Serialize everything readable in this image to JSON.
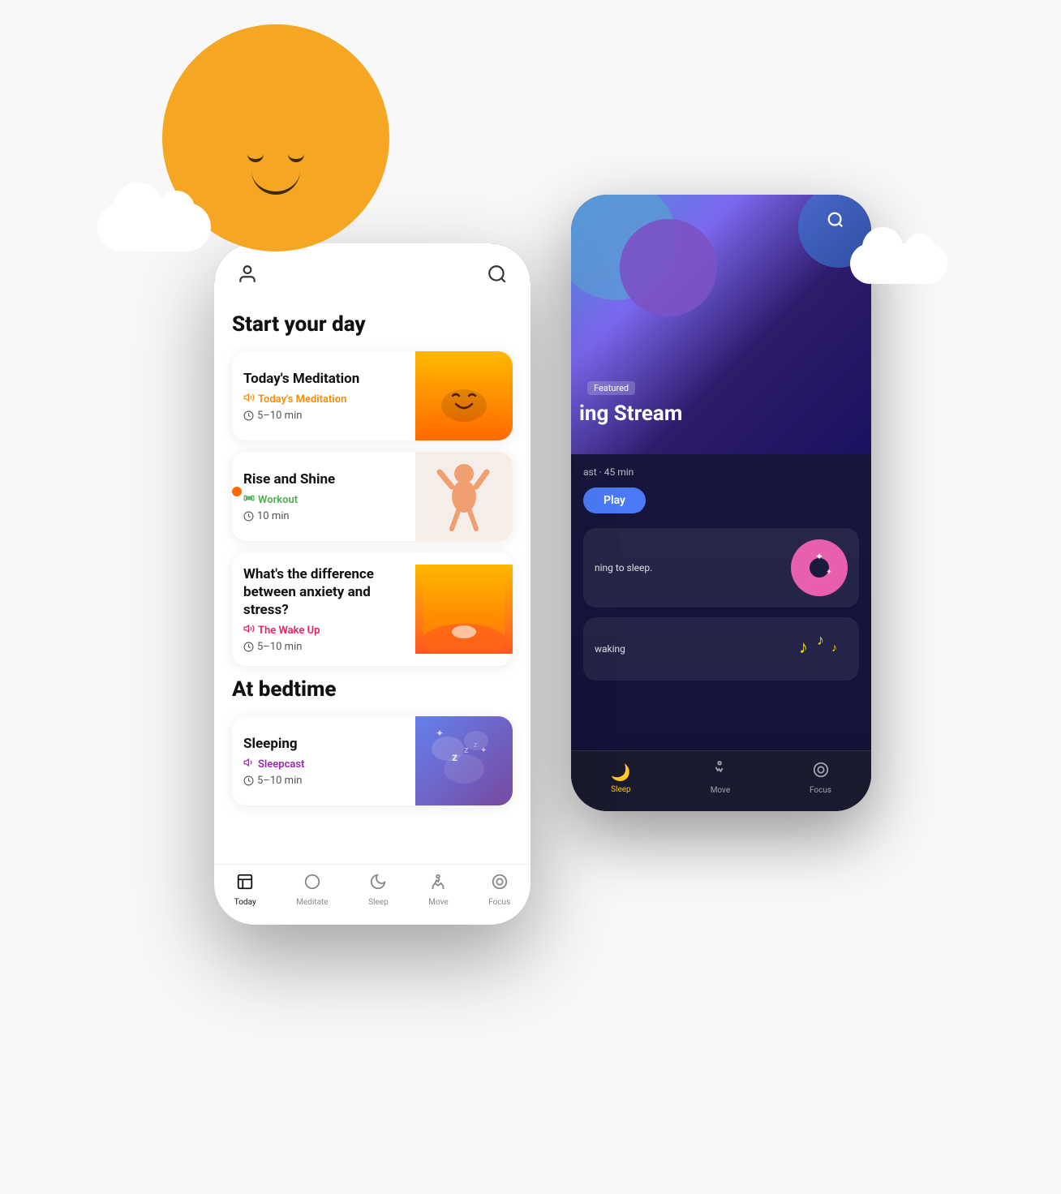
{
  "scene": {
    "background_color": "#f8f8f8"
  },
  "sun": {
    "alt": "Smiling sun character"
  },
  "front_phone": {
    "header": {
      "profile_icon": "👤",
      "search_icon": "🔍"
    },
    "section1_title": "Start your day",
    "cards": [
      {
        "id": "meditation",
        "title": "Today's Meditation",
        "category": "Today's Meditation",
        "category_color": "#FF8C00",
        "duration": "5–10 min",
        "img_type": "meditation"
      },
      {
        "id": "workout",
        "title": "Rise and Shine",
        "category": "Workout",
        "category_color": "#4CAF50",
        "duration": "10 min",
        "img_type": "workout"
      },
      {
        "id": "wakeup",
        "title": "What's the difference between anxiety and stress?",
        "category": "The Wake Up",
        "category_color": "#E91E63",
        "duration": "5–10 min",
        "img_type": "wakeup"
      }
    ],
    "section2_title": "At bedtime",
    "bedtime_cards": [
      {
        "id": "sleeping",
        "title": "Sleeping",
        "category": "Sleepcast",
        "category_color": "#9C27B0",
        "duration": "5–10 min",
        "img_type": "sleep"
      }
    ],
    "bottom_nav": [
      {
        "id": "today",
        "label": "Today",
        "icon": "🏠",
        "active": true
      },
      {
        "id": "meditate",
        "label": "Meditate",
        "icon": "○",
        "active": false
      },
      {
        "id": "sleep",
        "label": "Sleep",
        "icon": "🌙",
        "active": false
      },
      {
        "id": "move",
        "label": "Move",
        "icon": "♡",
        "active": false
      },
      {
        "id": "focus",
        "label": "Focus",
        "icon": "◎",
        "active": false
      }
    ]
  },
  "back_phone": {
    "search_icon": "🔍",
    "featured_label": "Featured",
    "stream_title": "ing Stream",
    "stream_subtitle": "ast · 45 min",
    "play_button": "Play",
    "sleep_card": {
      "text": "ning to sleep.",
      "icon": "🌙"
    },
    "wake_card": {
      "text": "waking",
      "icon": "♪"
    },
    "bottom_nav": [
      {
        "id": "sleep",
        "label": "Sleep",
        "icon": "🌙",
        "active": true
      },
      {
        "id": "move",
        "label": "Move",
        "icon": "♡",
        "active": false
      },
      {
        "id": "focus",
        "label": "Focus",
        "icon": "◎",
        "active": false
      }
    ]
  }
}
